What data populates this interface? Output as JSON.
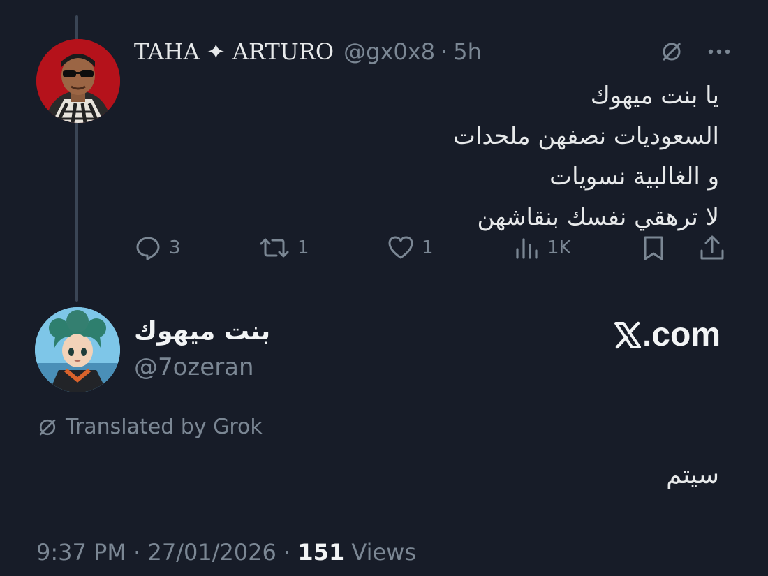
{
  "post": {
    "author_name": "TAHA ✦ ARTURO",
    "handle": "@gx0x8",
    "separator": "·",
    "time": "5h",
    "lines": [
      "يا بنت ميهوك",
      "السعوديات نصفهن ملحدات",
      "و الغالبية نسويات",
      "لا ترهقي نفسك بنقاشهن"
    ],
    "actions": {
      "replies": "3",
      "reposts": "1",
      "likes": "1",
      "views": "1K"
    }
  },
  "reply": {
    "author_name": "بنت ميهوك",
    "handle": "@7ozeran",
    "brand": ".com",
    "translated_label": "Translated by Grok",
    "text": "سيتم",
    "footer": {
      "time": "9:37 PM",
      "sep1": "·",
      "date": "27/01/2026",
      "sep2": "·",
      "views_count": "151",
      "views_label": "Views"
    }
  },
  "colors": {
    "background": "#171c28",
    "muted": "#7b8794",
    "text": "#e7e9ea",
    "thread_line": "#3a4555"
  },
  "icons": [
    "grok-icon",
    "more-icon",
    "reply-icon",
    "repost-icon",
    "like-icon",
    "views-icon",
    "bookmark-icon",
    "share-icon",
    "x-logo-icon"
  ]
}
